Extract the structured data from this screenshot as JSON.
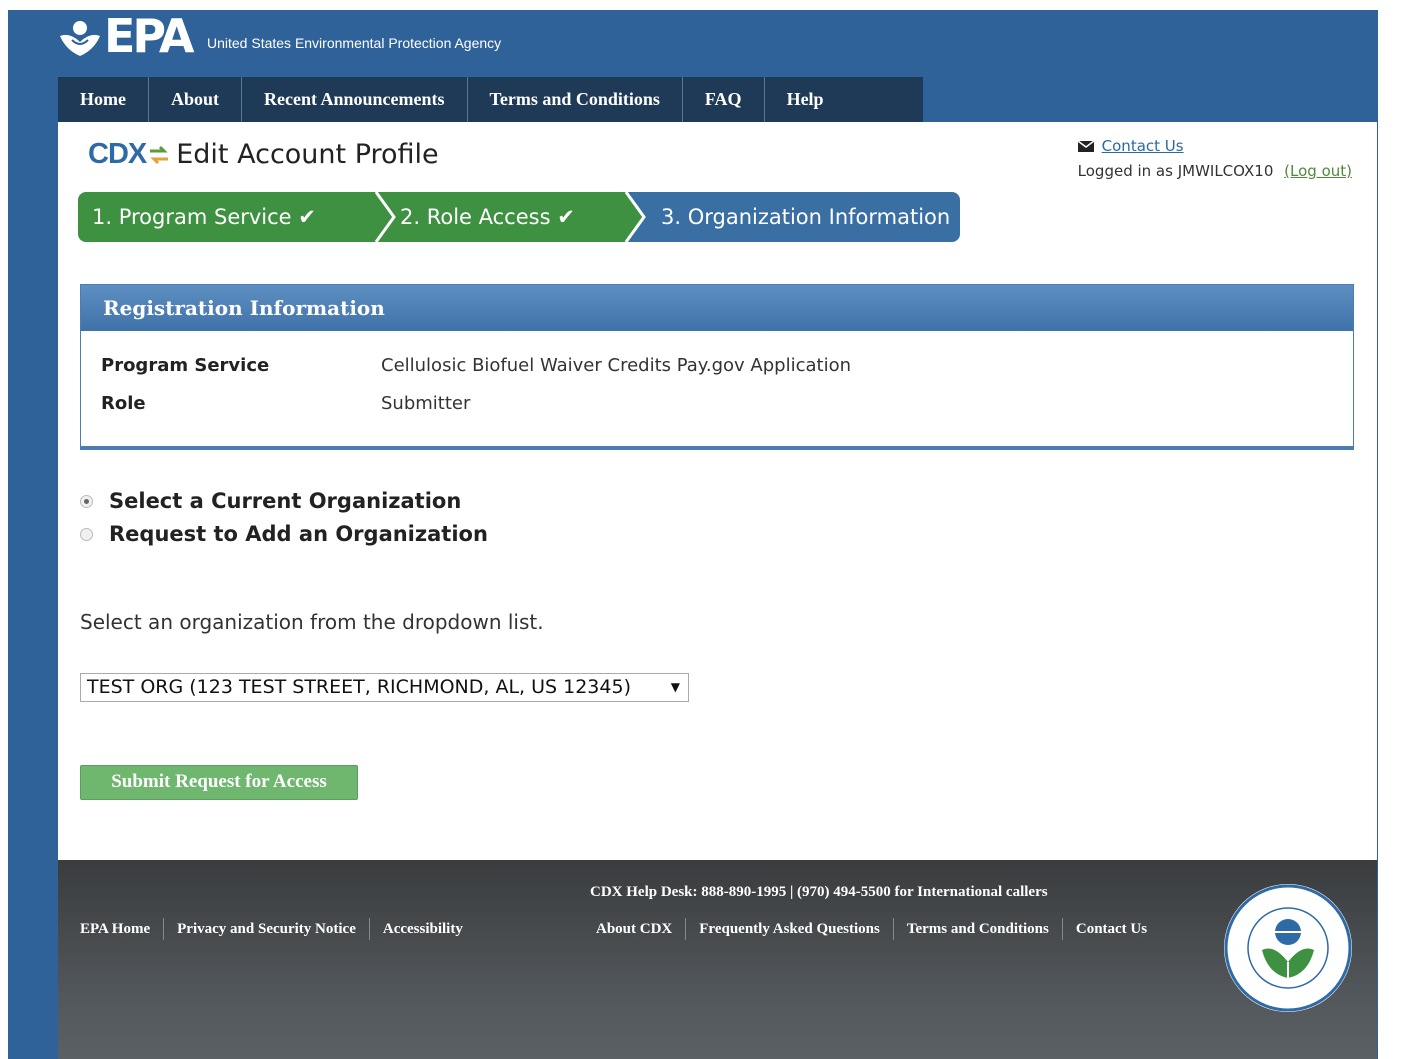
{
  "header": {
    "logo_text": "EPA",
    "agency_name": "United States Environmental Protection Agency"
  },
  "nav": {
    "items": [
      "Home",
      "About",
      "Recent Announcements",
      "Terms and Conditions",
      "FAQ",
      "Help"
    ]
  },
  "page": {
    "cdx_logo": "CDX",
    "title": "Edit Account Profile",
    "contact_us": "Contact Us",
    "logged_in_text": "Logged in as JMWILCOX10",
    "log_out": "(Log out)"
  },
  "steps": [
    {
      "label": "1. Program Service",
      "status": "complete",
      "check": "✔"
    },
    {
      "label": "2. Role Access",
      "status": "complete",
      "check": "✔"
    },
    {
      "label": "3. Organization Information",
      "status": "current"
    }
  ],
  "registration": {
    "heading": "Registration Information",
    "rows": [
      {
        "label": "Program Service",
        "value": "Cellulosic Biofuel Waiver Credits Pay.gov Application"
      },
      {
        "label": "Role",
        "value": "Submitter"
      }
    ]
  },
  "org_options": {
    "select_current": "Select a Current Organization",
    "request_add": "Request to Add an Organization",
    "selected": "select_current"
  },
  "instruction": "Select an organization from the dropdown list.",
  "org_select": {
    "value": "TEST ORG (123 TEST STREET, RICHMOND, AL, US 12345)"
  },
  "submit_label": "Submit Request for Access",
  "footer": {
    "helpdesk": "CDX Help Desk: 888-890-1995 | (970) 494-5500 for International callers",
    "left_links": [
      "EPA Home",
      "Privacy and Security Notice",
      "Accessibility"
    ],
    "right_links": [
      "About CDX",
      "Frequently Asked Questions",
      "Terms and Conditions",
      "Contact Us"
    ]
  },
  "colors": {
    "brand_blue": "#2f6299",
    "nav_dark": "#1f3a57",
    "step_green": "#3d9140",
    "step_blue": "#3a6fa4",
    "button_green": "#6fb66f"
  },
  "icons": [
    "epa-flower-icon",
    "cdx-arrows-icon",
    "envelope-icon",
    "checkmark-icon",
    "epa-seal-icon",
    "dropdown-arrow-icon"
  ]
}
